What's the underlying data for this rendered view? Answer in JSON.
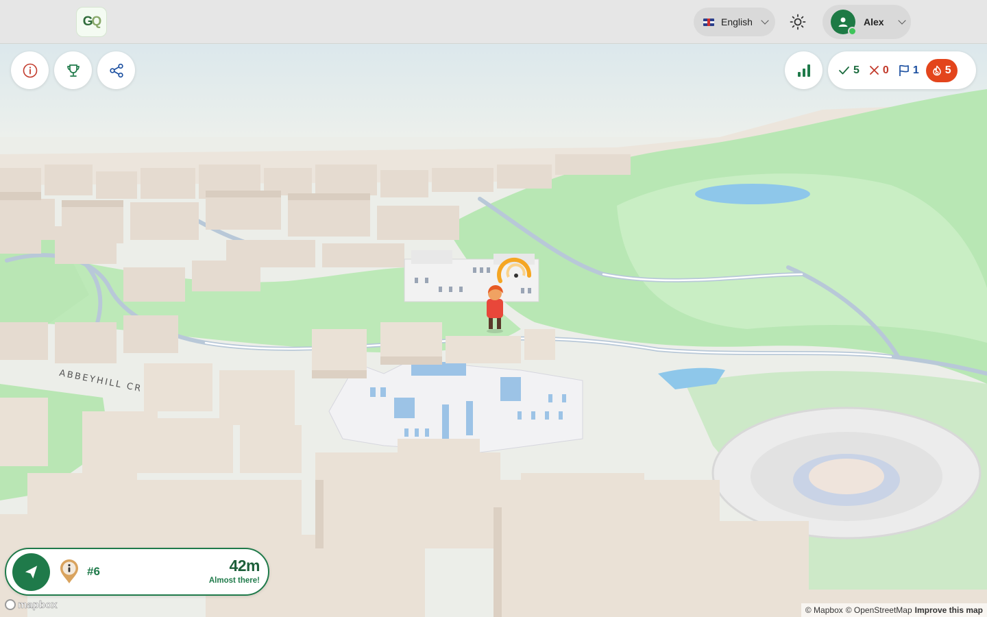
{
  "topbar": {
    "logo_text": "GQ",
    "language": {
      "label": "English",
      "flag": "uk-flag-icon"
    },
    "theme_icon": "sun-icon",
    "user": {
      "name": "Alex",
      "online": true
    }
  },
  "toolbar": {
    "info_icon": "info-icon",
    "trophy_icon": "trophy-icon",
    "share_icon": "share-icon",
    "stats_icon": "bar-chart-icon"
  },
  "score": {
    "correct": "5",
    "wrong": "0",
    "flags": "1",
    "streak": "5"
  },
  "map": {
    "street_label": "ABBEYHILL CR",
    "logo": "mapbox",
    "attribution_1": "© Mapbox",
    "attribution_2": "© OpenStreetMap",
    "attribution_improve": "Improve this map"
  },
  "distance_panel": {
    "clue_number": "#6",
    "distance": "42m",
    "status": "Almost there!"
  },
  "colors": {
    "brand_green": "#1f7a4a",
    "streak_orange": "#e3451c",
    "error_red": "#c23a2b",
    "flag_blue": "#1b4fa0"
  }
}
